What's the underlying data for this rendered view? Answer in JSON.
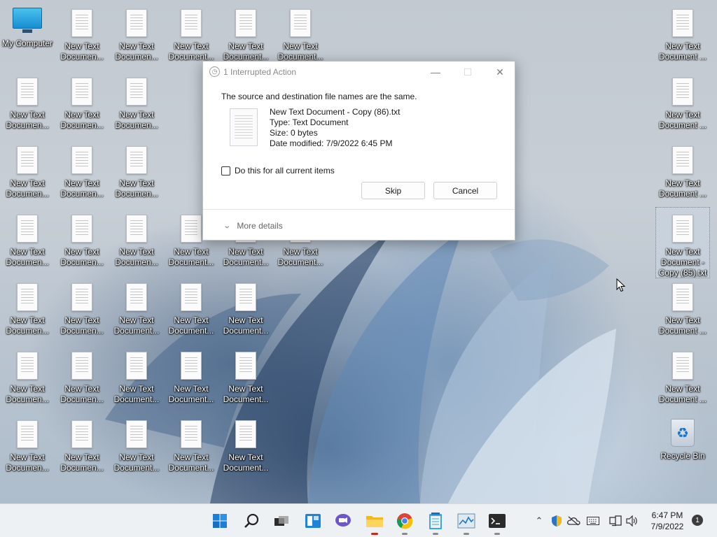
{
  "desktop": {
    "my_computer_label": "My Computer",
    "recycle_bin_label": "Recycle Bin",
    "doc_label_trunc_a": "New Text\nDocumen...",
    "doc_label_trunc_b": "New Text\nDocument...",
    "doc_label_right": "New Text\nDocument ...",
    "selected_doc_label": "New Text\nDocument -\nCopy (85).txt"
  },
  "dialog": {
    "title": "1 Interrupted Action",
    "message": "The source and destination file names are the same.",
    "file_name": "New Text Document - Copy (86).txt",
    "file_type": "Type: Text Document",
    "file_size": "Size: 0 bytes",
    "file_modified": "Date modified: 7/9/2022 6:45 PM",
    "checkbox_label": "Do this for all current items",
    "skip_label": "Skip",
    "cancel_label": "Cancel",
    "more_details_label": "More details"
  },
  "taskbar": {
    "clock_time": "6:47 PM",
    "clock_date": "7/9/2022",
    "notification_count": "1",
    "apps": [
      "start-icon",
      "search-icon",
      "task-view-icon",
      "widgets-icon",
      "chat-icon",
      "file-explorer-icon",
      "chrome-icon",
      "notepad-icon",
      "task-manager-icon",
      "terminal-icon"
    ]
  },
  "colors": {
    "accent": "#0067c0",
    "taskbar_bg": "#eef1f4"
  }
}
